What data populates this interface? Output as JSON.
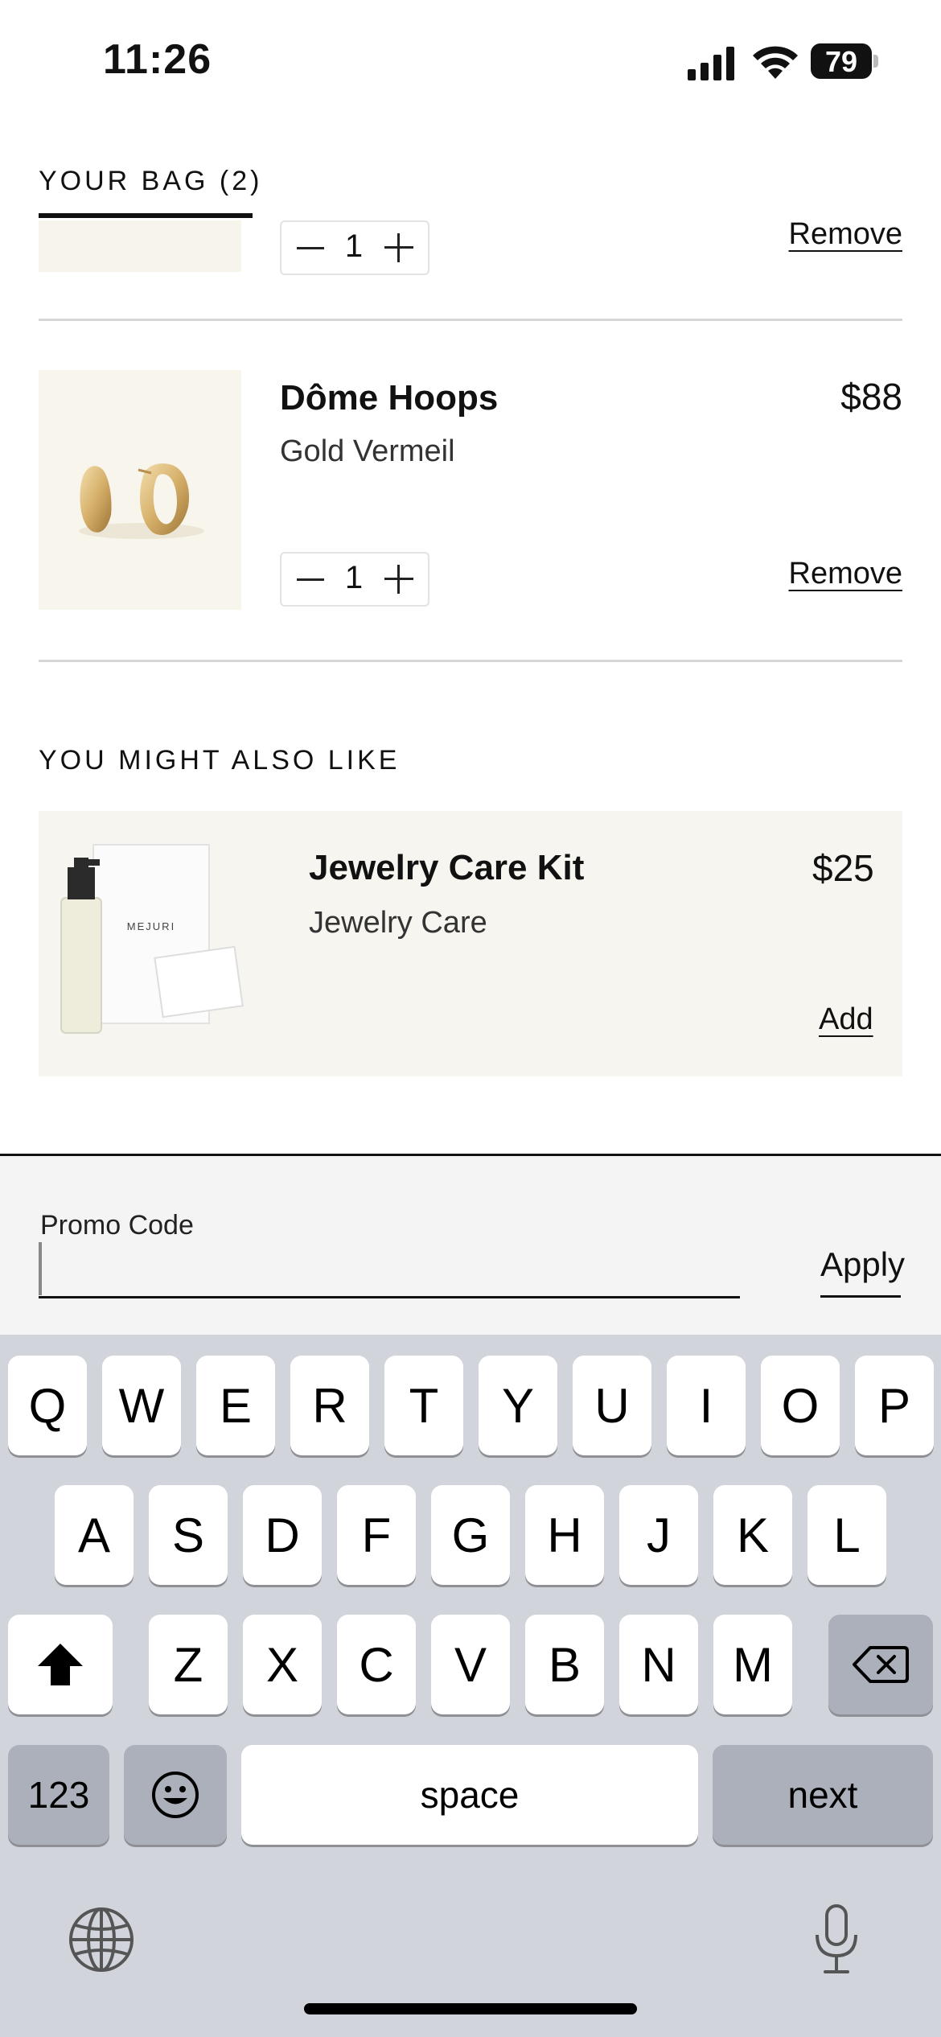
{
  "status_bar": {
    "time": "11:26",
    "battery": "79"
  },
  "header": {
    "bag_title": "YOUR BAG (2)"
  },
  "cart": {
    "items": [
      {
        "quantity": "1",
        "remove_label": "Remove"
      },
      {
        "name": "Dôme Hoops",
        "variant": "Gold Vermeil",
        "price": "$88",
        "quantity": "1",
        "remove_label": "Remove"
      }
    ]
  },
  "recommendations": {
    "title": "YOU MIGHT ALSO LIKE",
    "items": [
      {
        "name": "Jewelry Care Kit",
        "category": "Jewelry Care",
        "price": "$25",
        "add_label": "Add",
        "product_text": "MEJURI"
      }
    ]
  },
  "promo": {
    "label": "Promo Code",
    "value": "",
    "apply_label": "Apply"
  },
  "keyboard": {
    "row1": [
      "Q",
      "W",
      "E",
      "R",
      "T",
      "Y",
      "U",
      "I",
      "O",
      "P"
    ],
    "row2": [
      "A",
      "S",
      "D",
      "F",
      "G",
      "H",
      "J",
      "K",
      "L"
    ],
    "row3": [
      "Z",
      "X",
      "C",
      "V",
      "B",
      "N",
      "M"
    ],
    "numbers_label": "123",
    "space_label": "space",
    "next_label": "next"
  },
  "colors": {
    "thumb_bg": "#f8f5ec",
    "card_bg": "#f7f5f0",
    "keyboard_bg": "#d1d4db"
  }
}
